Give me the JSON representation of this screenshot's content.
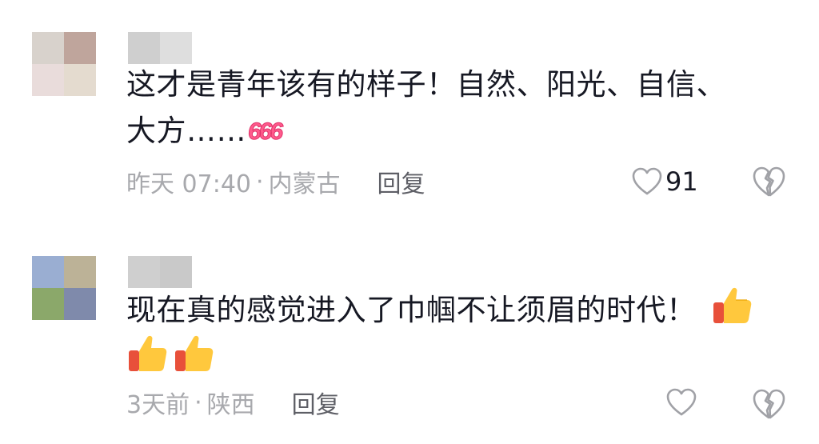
{
  "comments": [
    {
      "avatar_colors": [
        "#d8d2cc",
        "#bfa59c",
        "#e9dcdb",
        "#e4dbcf"
      ],
      "username_colors": [
        "#cfcfcf",
        "#dedede"
      ],
      "text_line1": "这才是青年该有的样子！自然、阳光、自信、",
      "text_line2": "大方……",
      "sticker": "666",
      "time": "昨天 07:40",
      "separator": "·",
      "location": "内蒙古",
      "reply_label": "回复",
      "like_count": "91",
      "like_icon": "heart-outline-icon",
      "dislike_icon": "broken-heart-icon"
    },
    {
      "avatar_colors": [
        "#9aaed2",
        "#bcb297",
        "#8ba86a",
        "#7f8aab"
      ],
      "username_colors": [
        "#cfcfcf",
        "#c9c9c9"
      ],
      "text_line1": "现在真的感觉进入了巾帼不让须眉的时代！",
      "emoji": "thumbs-up-icon",
      "time": "3天前",
      "separator": "·",
      "location": "陕西",
      "reply_label": "回复",
      "like_count": "",
      "like_icon": "heart-outline-icon",
      "dislike_icon": "broken-heart-icon"
    }
  ],
  "colors": {
    "text": "#161823",
    "meta": "#a8a9ad",
    "reply": "#5e5f66",
    "icon_stroke": "#a0a1a6"
  }
}
